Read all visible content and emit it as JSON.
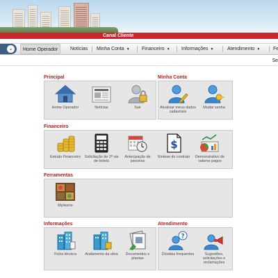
{
  "app": {
    "title": "Canal Cliente"
  },
  "nav": {
    "items": [
      {
        "label": "Home Operador"
      },
      {
        "label": "Notícias"
      },
      {
        "label": "Minha Conta"
      },
      {
        "label": "Financeiro"
      },
      {
        "label": "Informações"
      },
      {
        "label": "Atendimento"
      },
      {
        "label": "Fe"
      }
    ],
    "arrow": "▼"
  },
  "subbar": {
    "text": "Se"
  },
  "sections": {
    "principal": {
      "title": "Principal",
      "tiles": [
        {
          "label": "Home Operador",
          "icon": "home-icon"
        },
        {
          "label": "Notícias",
          "icon": "newspaper-icon"
        },
        {
          "label": "Sair",
          "icon": "user-logout-icon"
        }
      ]
    },
    "minha_conta": {
      "title": "Minha Conta",
      "tiles": [
        {
          "label": "Atualizar meus dados cadastrais",
          "icon": "user-edit-icon"
        },
        {
          "label": "Mudar senha",
          "icon": "user-key-icon"
        }
      ]
    },
    "financeiro": {
      "title": "Financeiro",
      "tiles": [
        {
          "label": "Extrato Financeiro",
          "icon": "coins-icon"
        },
        {
          "label": "Solicitação de 2ª via de boleto",
          "icon": "calculator-icon"
        },
        {
          "label": "Antecipação de parcelas",
          "icon": "calendar-clock-icon"
        },
        {
          "label": "Síntese do contrato",
          "icon": "dollar-document-icon"
        },
        {
          "label": "Demonstrativo de valores pagos",
          "icon": "chart-icon"
        }
      ]
    },
    "ferramentas": {
      "title": "Ferramentas",
      "tiles": [
        {
          "label": "MyHome",
          "icon": "myhome-icon"
        }
      ]
    },
    "informacoes": {
      "title": "Informações",
      "tiles": [
        {
          "label": "Ficha técnica",
          "icon": "buildings-icon"
        },
        {
          "label": "Andamento da obra",
          "icon": "construction-icon"
        },
        {
          "label": "Documentos e plantas",
          "icon": "documents-icon"
        }
      ]
    },
    "atendimento": {
      "title": "Atendimento",
      "tiles": [
        {
          "label": "Dúvidas frequentes",
          "icon": "user-question-icon"
        },
        {
          "label": "Sugestões, solicitações e reclamações",
          "icon": "user-megaphone-icon"
        }
      ]
    }
  },
  "colors": {
    "brand_red": "#c8262b",
    "section_title": "#b71c1c",
    "panel_bg": "#e6e6e6",
    "nav_blue": "#3f5e86"
  }
}
